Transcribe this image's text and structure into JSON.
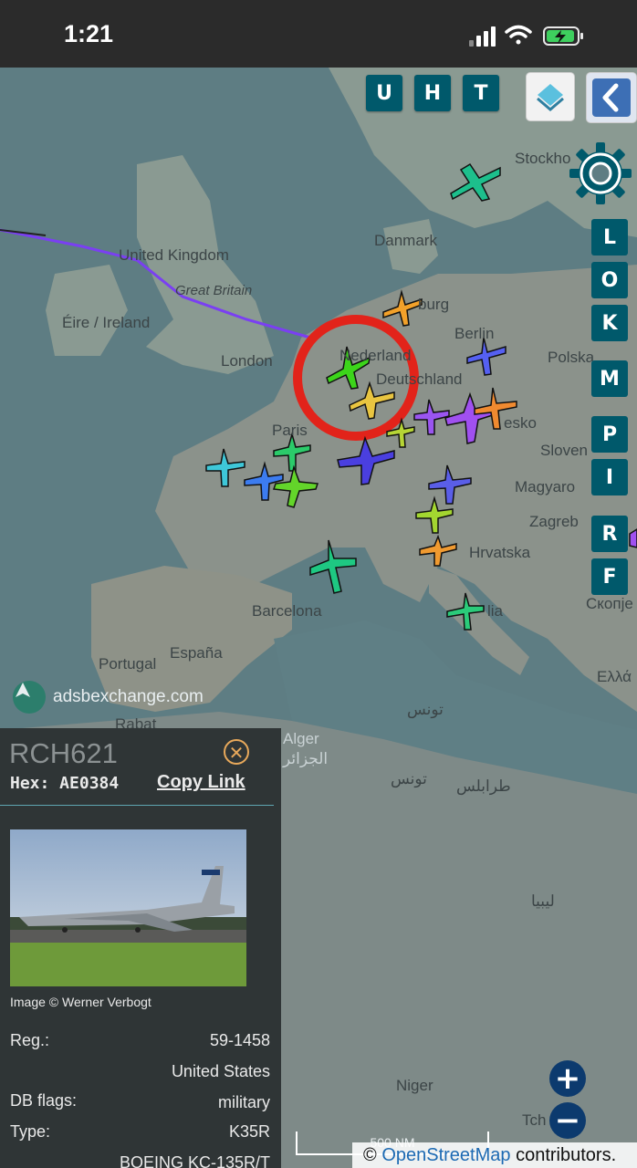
{
  "status_bar": {
    "time": "1:21"
  },
  "map": {
    "labels": {
      "uk": "United Kingdom",
      "gb": "Great Britain",
      "ireland": "Éire / Ireland",
      "london": "London",
      "paris": "Paris",
      "danmark": "Danmark",
      "stockholm": "Stockho",
      "hamburg": "burg",
      "berlin": "Berlin",
      "polska": "Polska",
      "nederland": "Nederland",
      "deutschland": "Deutschland",
      "cesko": "esko",
      "slovensko": "Sloven",
      "magyarorszag": "Magyaro",
      "zagreb": "Zagreb",
      "hrvatska": "Hrvatska",
      "barcelona": "Barcelona",
      "portugal": "Portugal",
      "espana": "España",
      "italia": "lia",
      "skopje": "Скопје",
      "ellada": "Ελλά",
      "rabat": "Rabat",
      "alger": "Alger",
      "alger_ar": "الجزائر",
      "tunis": "تونس",
      "tunis2": "تونس",
      "tripoli": "طرابلس",
      "libya": "ليبيا",
      "niger": "Niger",
      "tchad": "Tch"
    },
    "watermark": "adsbexchange.com",
    "top_buttons": [
      "U",
      "H",
      "T"
    ],
    "side_buttons": [
      "L",
      "O",
      "K",
      "M",
      "P",
      "I",
      "R",
      "F"
    ],
    "zoom_in": "+",
    "zoom_out": "−",
    "scale_label": "500 NM",
    "attribution_prefix": "©",
    "attribution_link": "OpenStreetMap",
    "attribution_suffix": "contributors."
  },
  "panel": {
    "callsign": "RCH621",
    "hex_label": "Hex: AE0384",
    "copy_link": "Copy Link",
    "photo_credit": "Image © Werner Verbogt",
    "rows": [
      {
        "label": "Reg.:",
        "value": "59-1458"
      },
      {
        "label": "",
        "value": "United States"
      },
      {
        "label": "DB flags:",
        "value": "military"
      },
      {
        "label": "Type:",
        "value": "K35R"
      },
      {
        "label": "",
        "value": "BOEING KC-135R/T"
      }
    ]
  },
  "colors": {
    "button_teal": "#00596b",
    "highlight_ring": "#e2231a",
    "zoom_blue": "#0c3a6e"
  }
}
